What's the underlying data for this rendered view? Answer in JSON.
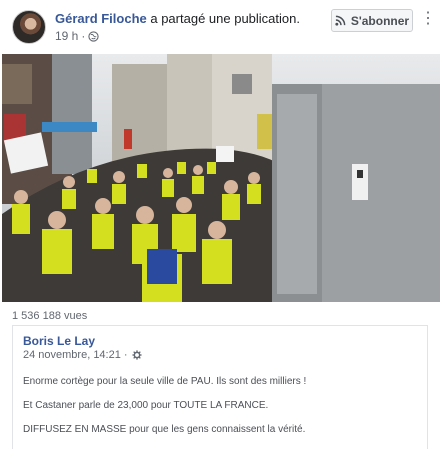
{
  "post": {
    "author": "Gérard Filoche",
    "action": " a partagé une publication.",
    "time": "19 h",
    "privacy_icon": "globe-icon",
    "subscribe_label": "S'abonner",
    "subscribe_icon": "rss-icon",
    "more_icon": "more-vertical-icon"
  },
  "video": {
    "views": "1 536 188 vues",
    "mute_icon": "speaker-muted-icon"
  },
  "shared": {
    "author": "Boris Le Lay",
    "date": "24 novembre, 14:21 · ",
    "settings_icon": "gear-icon",
    "lines": [
      "Enorme cortège pour la seule ville de PAU. Ils sont des milliers !",
      "Et Castaner parle de 23,000 pour TOUTE LA FRANCE.",
      "DIFFUSEZ EN MASSE pour que les gens connaissent la vérité."
    ]
  },
  "colors": {
    "link": "#385898",
    "vest_yellow": "#d4e01f",
    "secondary_text": "#616770"
  }
}
